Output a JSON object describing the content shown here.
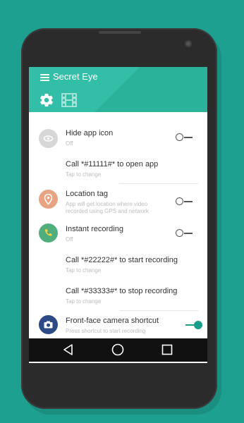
{
  "app": {
    "title": "Secret Eye"
  },
  "tabs": [
    {
      "icon": "gear-icon"
    },
    {
      "icon": "film-icon"
    }
  ],
  "settings": [
    {
      "icon": "eye-off-icon",
      "title": "Hide app icon",
      "subtitle": "Off",
      "toggle": "off"
    },
    {
      "title": "Call *#11111#* to open app",
      "subtitle": "Tap to change"
    },
    {
      "icon": "location-pin-icon",
      "title": "Location tag",
      "subtitle_lines": [
        "App will get location where video",
        "recorded using GPS and network"
      ],
      "toggle": "off"
    },
    {
      "icon": "phone-call-icon",
      "title": "Instant recording",
      "subtitle": "Off",
      "toggle": "off"
    },
    {
      "title": "Call *#22222#* to start recording",
      "subtitle": "Tap to change"
    },
    {
      "title": "Call *#33333#* to stop recording",
      "subtitle": "Tap to change"
    },
    {
      "icon": "camera-icon",
      "title": "Front-face camera shortcut",
      "subtitle": "Press shortcut to start recording",
      "toggle": "on"
    }
  ],
  "navbar": [
    {
      "icon": "back-icon"
    },
    {
      "icon": "home-icon"
    },
    {
      "icon": "recents-icon"
    }
  ],
  "colors": {
    "background": "#1da08f",
    "appbar": "#33bfa7",
    "accent": "#1a9e8a"
  }
}
